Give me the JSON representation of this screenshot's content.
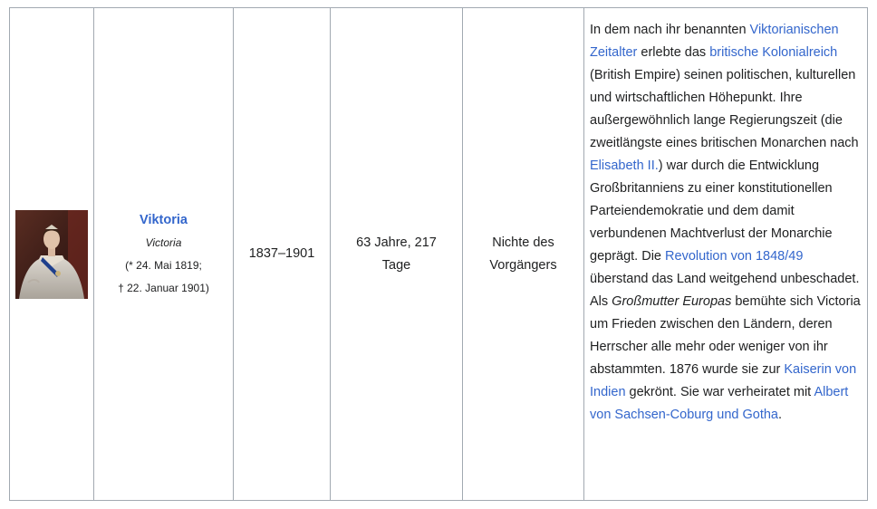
{
  "row": {
    "name": "Viktoria",
    "name_original": "Victoria",
    "born": "(* 24. Mai 1819;",
    "died": "† 22. Januar 1901)",
    "years": "1837–1901",
    "duration": "63 Jahre, 217 Tage",
    "relation": "Nichte des Vorgängers",
    "description": [
      {
        "t": "text",
        "v": "In dem nach ihr benannten "
      },
      {
        "t": "link",
        "v": "Viktorianischen Zeitalter"
      },
      {
        "t": "text",
        "v": " erlebte das "
      },
      {
        "t": "link",
        "v": "britische Kolonialreich"
      },
      {
        "t": "text",
        "v": " (British Empire) seinen politischen, kulturellen und wirtschaftlichen Höhepunkt. Ihre außergewöhnlich lange Regierungszeit (die zweitlängste eines britischen Monarchen nach "
      },
      {
        "t": "link",
        "v": "Elisabeth II."
      },
      {
        "t": "text",
        "v": ") war durch die Entwicklung Großbritanniens zu einer konstitutionellen Parteiendemokratie und dem damit verbundenen Machtverlust der Monarchie geprägt. Die "
      },
      {
        "t": "link",
        "v": "Revolution von 1848/49"
      },
      {
        "t": "text",
        "v": " überstand das Land weitgehend unbeschadet. Als "
      },
      {
        "t": "italic",
        "v": "Großmutter Europas"
      },
      {
        "t": "text",
        "v": " bemühte sich Victoria um Frieden zwischen den Ländern, deren Herrscher alle mehr oder weniger von ihr abstammten. 1876 wurde sie zur "
      },
      {
        "t": "link",
        "v": "Kaiserin von Indien"
      },
      {
        "t": "text",
        "v": " gekrönt. Sie war verheiratet mit "
      },
      {
        "t": "link",
        "v": "Albert von Sachsen-Coburg und Gotha"
      },
      {
        "t": "text",
        "v": "."
      }
    ]
  },
  "colors": {
    "link": "#3366cc",
    "border": "#a2a9b1",
    "text": "#202122"
  }
}
